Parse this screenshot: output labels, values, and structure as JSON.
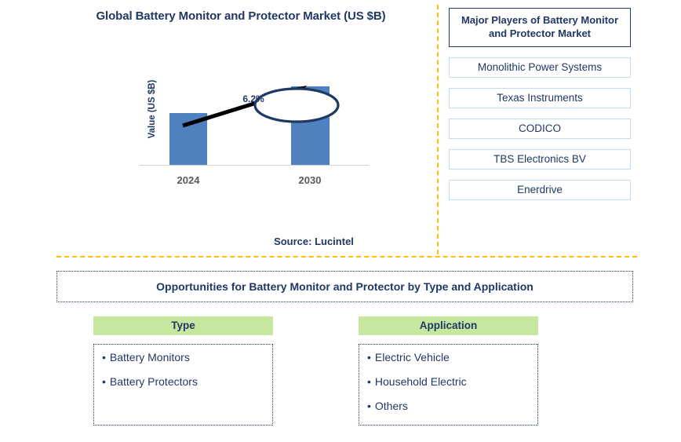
{
  "chart": {
    "title": "Global Battery Monitor and Protector Market (US $B)",
    "ylabel": "Value (US $B)",
    "cagr_label": "6.2%",
    "tick_2024": "2024",
    "tick_2030": "2030",
    "bar_color": "#4E81BD"
  },
  "chart_data": {
    "type": "bar",
    "title": "Global Battery Monitor and Protector Market (US $B)",
    "xlabel": "",
    "ylabel": "Value (US $B)",
    "categories": [
      "2024",
      "2030"
    ],
    "values": [
      0.66,
      1.0
    ],
    "ylim": [
      0,
      1.15
    ],
    "grid": false,
    "legend": "none",
    "annotations": [
      {
        "text": "6.2%",
        "type": "cagr-callout-ellipse-with-arrow",
        "from": "2024",
        "to": "2030"
      }
    ],
    "series": [
      {
        "name": "Value (US $B)",
        "values": [
          0.66,
          1.0
        ],
        "color": "#4E81BD"
      }
    ]
  },
  "source": {
    "note": "Source: Lucintel"
  },
  "players": {
    "header": "Major Players of Battery Monitor and Protector Market",
    "items": [
      {
        "label": "Monolithic Power Systems"
      },
      {
        "label": "Texas Instruments"
      },
      {
        "label": "CODICO"
      },
      {
        "label": "TBS Electronics BV"
      },
      {
        "label": "Enerdrive"
      }
    ]
  },
  "opportunities": {
    "title": "Opportunities for Battery Monitor and Protector by Type and Application",
    "columns": [
      {
        "header": "Type",
        "items": [
          {
            "bullet": "•",
            "label": "Battery Monitors"
          },
          {
            "bullet": "•",
            "label": "Battery Protectors"
          }
        ]
      },
      {
        "header": "Application",
        "items": [
          {
            "bullet": "•",
            "label": "Electric Vehicle"
          },
          {
            "bullet": "•",
            "label": "Household Electric"
          },
          {
            "bullet": "•",
            "label": "Others"
          }
        ]
      }
    ]
  },
  "colors": {
    "navy": "#1F3864",
    "bar_blue": "#4E81BD",
    "divider_amber": "#FFC000",
    "header_green": "#C7E6A0",
    "player_border": "#C5DCEC"
  }
}
